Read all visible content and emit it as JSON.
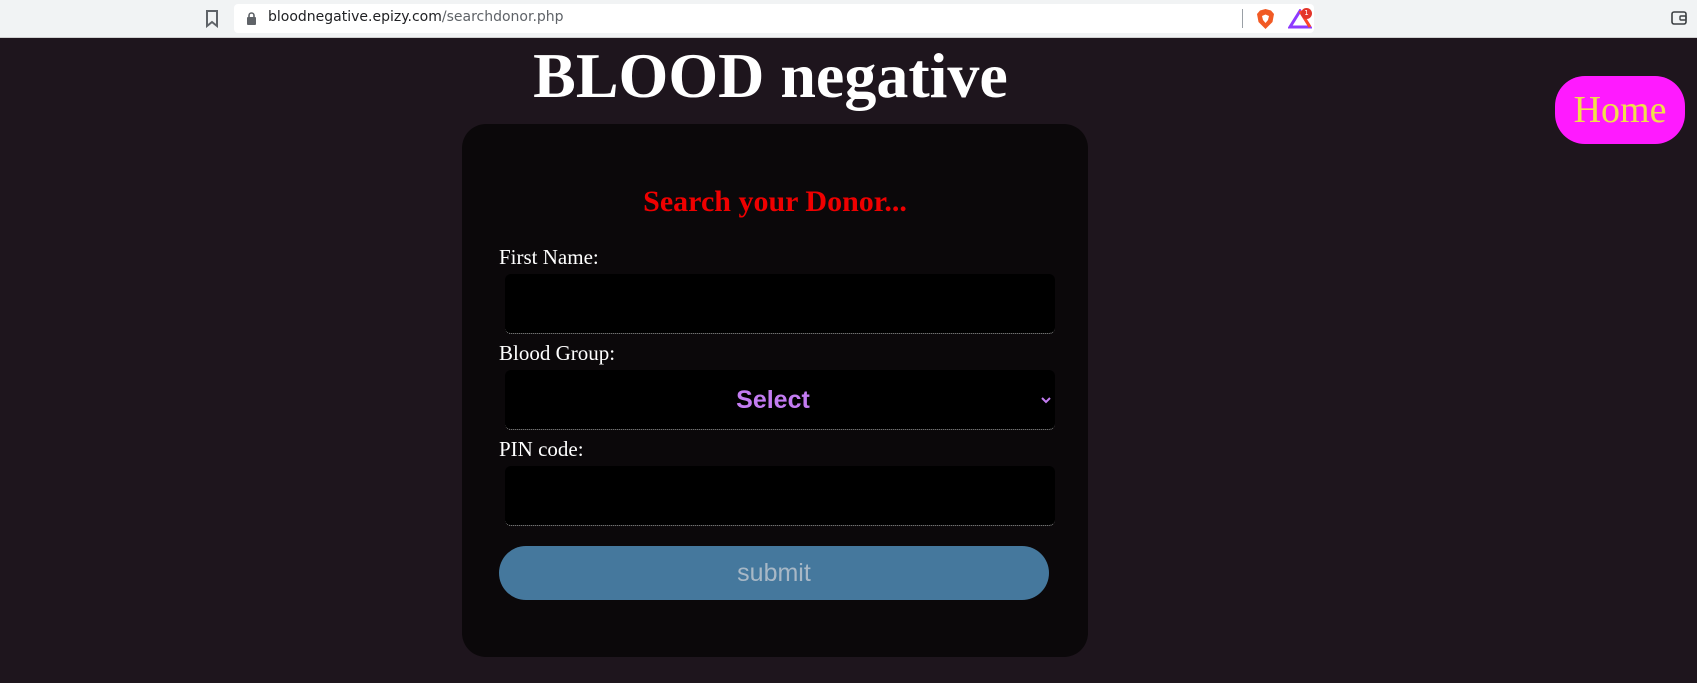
{
  "browser": {
    "url_host": "bloodnegative.epizy.com",
    "url_path": "/searchdonor.php",
    "rewards_badge": "1",
    "icons": [
      "bookmark-icon",
      "lock-icon",
      "brave-shield-icon",
      "brave-rewards-icon",
      "wallet-icon"
    ]
  },
  "header": {
    "title": "BLOOD negative",
    "home_label": "Home"
  },
  "form": {
    "title": "Search your Donor...",
    "first_name_label": "First Name:",
    "first_name_value": "",
    "blood_group_label": "Blood Group:",
    "blood_group_selected": "Select",
    "pin_label": "PIN code:",
    "pin_value": "",
    "submit_label": "submit"
  },
  "colors": {
    "page_bg": "#1e151d",
    "card_bg": "#0b080a",
    "form_title": "#ef0000",
    "home_button_bg": "#ff1aff",
    "home_button_text": "#f1e04a",
    "select_text": "#c37cf2",
    "submit_bg": "#45789d"
  }
}
